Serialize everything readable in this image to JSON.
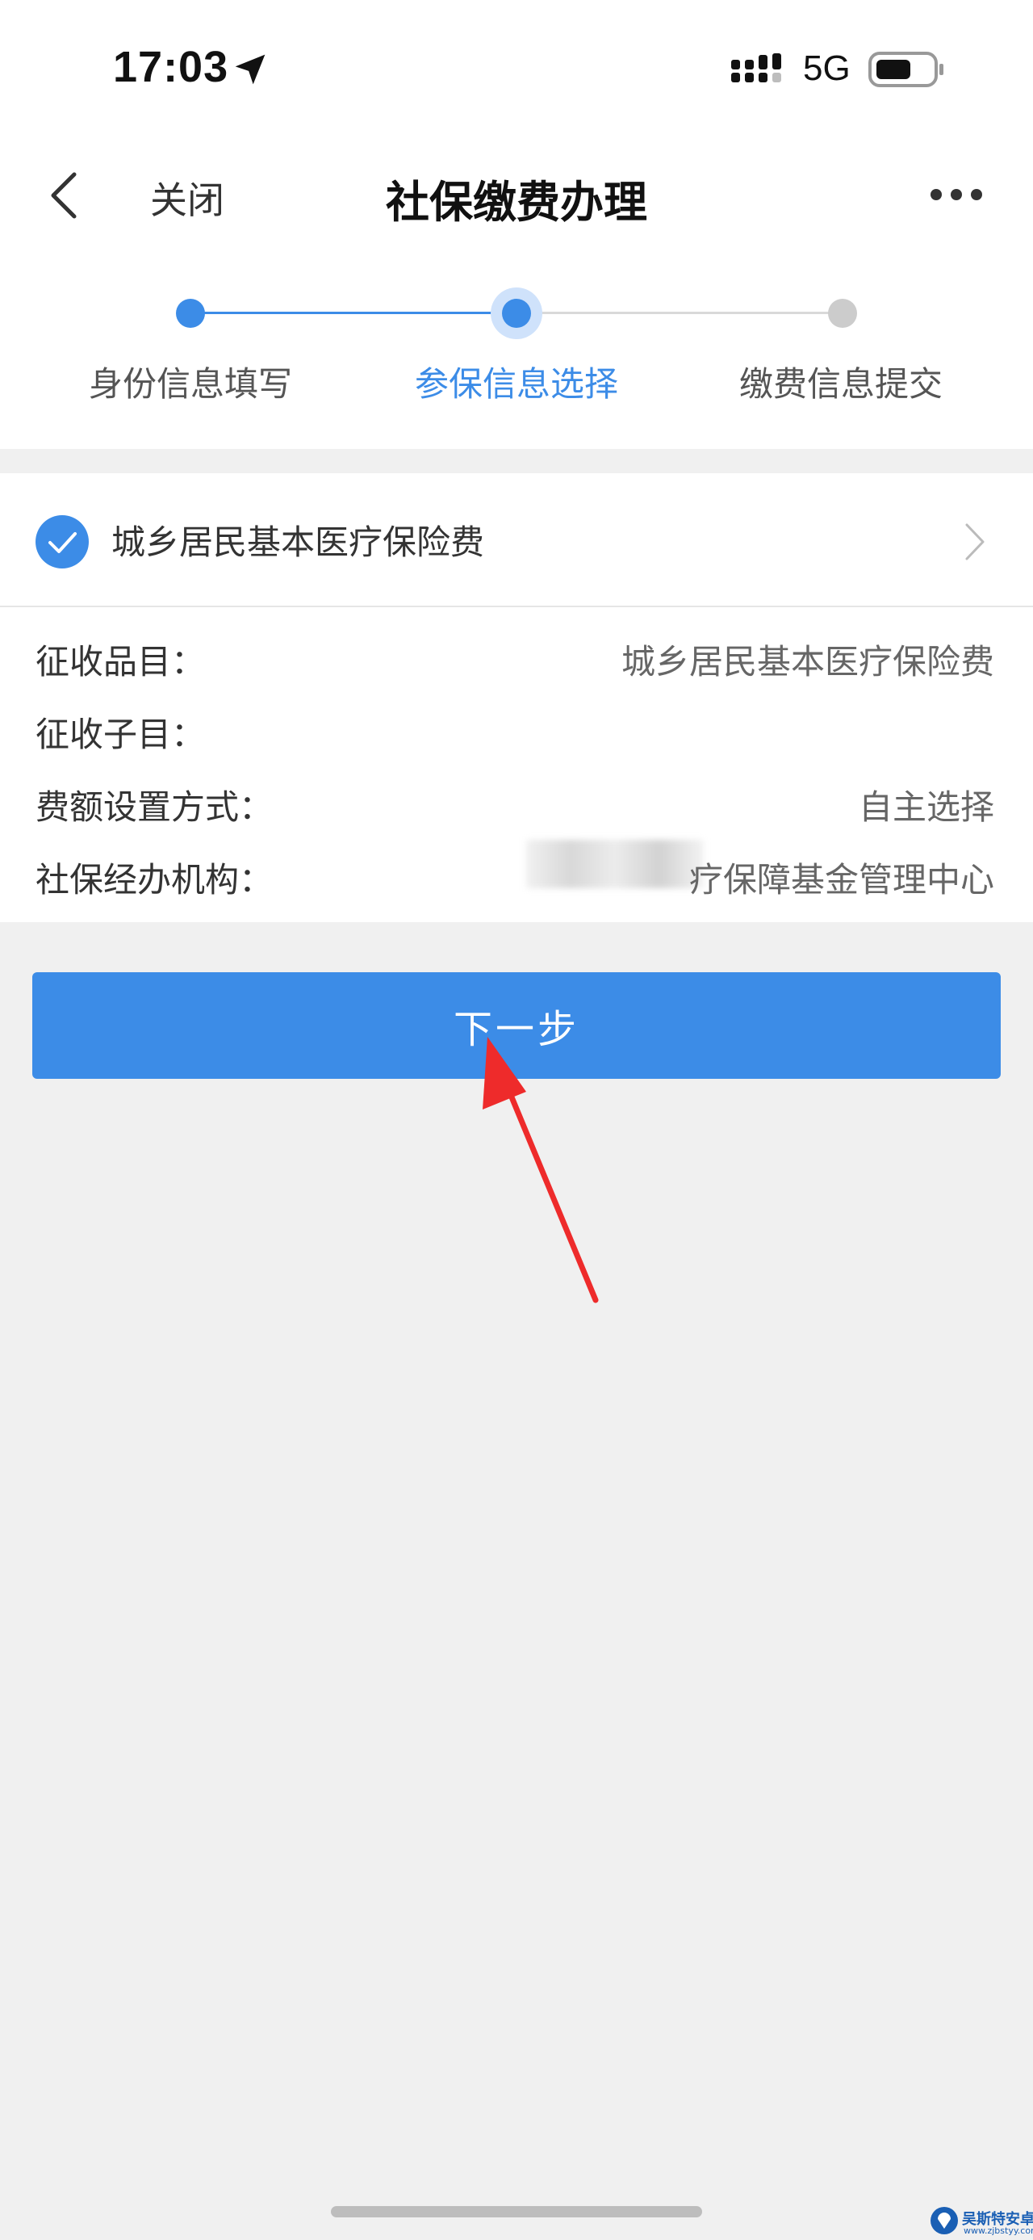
{
  "status_bar": {
    "time": "17:03",
    "network": "5G"
  },
  "nav": {
    "close_label": "关闭",
    "title": "社保缴费办理"
  },
  "steps": [
    {
      "label": "身份信息填写",
      "state": "done"
    },
    {
      "label": "参保信息选择",
      "state": "active"
    },
    {
      "label": "缴费信息提交",
      "state": "todo"
    }
  ],
  "insurance": {
    "name": "城乡居民基本医疗保险费",
    "checked": true,
    "details": [
      {
        "label": "征收品目：",
        "value": "城乡居民基本医疗保险费"
      },
      {
        "label": "征收子目：",
        "value": ""
      },
      {
        "label": "费额设置方式：",
        "value": "自主选择"
      },
      {
        "label": "社保经办机构：",
        "value": "疗保障基金管理中心"
      }
    ]
  },
  "next_button": {
    "label": "下一步"
  },
  "watermark": {
    "text": "吴斯特安卓网",
    "url": "www.zjbstyy.com"
  },
  "colors": {
    "accent": "#3c8ce7",
    "arrow": "#ee2b2b",
    "background": "#f0f0f0"
  }
}
